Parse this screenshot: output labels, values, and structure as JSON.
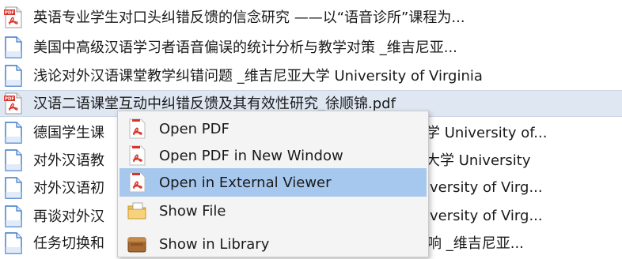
{
  "files": [
    {
      "name": "英语专业学生对口头纠错反馈的信念研究 ——以“语音诊所”课程为...",
      "icon": "pdf-icon"
    },
    {
      "name": "美国中高级汉语学习者语音偏误的统计分析与教学对策 _维吉尼亚...",
      "icon": "document-icon"
    },
    {
      "name": "浅论对外汉语课堂教学纠错问题 _维吉尼亚大学 University of Virginia",
      "icon": "document-icon"
    },
    {
      "name": "汉语二语课堂互动中纠错反馈及其有效性研究_徐顺锦.pdf",
      "icon": "pdf-icon"
    },
    {
      "name": "德国学生课",
      "suffix": "学 University of...",
      "icon": "document-icon"
    },
    {
      "name": "对外汉语教",
      "suffix": "大学 University",
      "icon": "document-icon"
    },
    {
      "name": "对外汉语初",
      "suffix": "iversity of Virg...",
      "icon": "document-icon"
    },
    {
      "name": "再谈对外汉",
      "suffix": "iversity of Virg...",
      "icon": "document-icon"
    },
    {
      "name": "任务切换和",
      "suffix": "响 _维吉尼亚...",
      "icon": "document-icon"
    }
  ],
  "context_menu": {
    "items": [
      {
        "label": "Open PDF",
        "icon": "pdf-icon"
      },
      {
        "label": "Open PDF in New Window",
        "icon": "pdf-icon"
      },
      {
        "label": "Open in External Viewer",
        "icon": "pdf-icon",
        "highlighted": true
      },
      {
        "label": "Show File",
        "icon": "folder-icon"
      },
      {
        "label": "Show in Library",
        "icon": "library-icon"
      }
    ]
  },
  "colors": {
    "selection": "#dfe7f3",
    "menu_highlight": "#a6c8ee",
    "pdf_red": "#d9342b",
    "doc_blue": "#3a78c8"
  }
}
